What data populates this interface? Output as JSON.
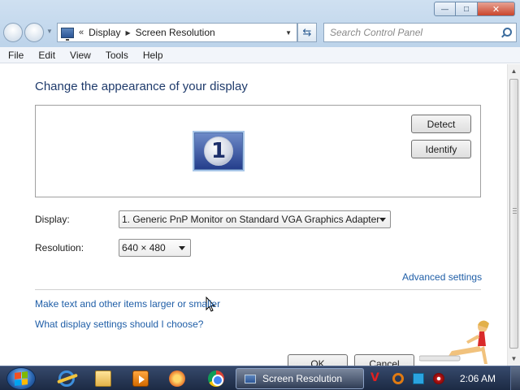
{
  "window": {
    "title": "Screen Resolution",
    "controls": {
      "minimize": "—",
      "maximize": "□",
      "close": "✕"
    }
  },
  "nav": {
    "chevrons": "«",
    "breadcrumbs": [
      "Display",
      "Screen Resolution"
    ],
    "search_placeholder": "Search Control Panel",
    "refresh_glyph": "⇆"
  },
  "menu": {
    "items": [
      "File",
      "Edit",
      "View",
      "Tools",
      "Help"
    ]
  },
  "main": {
    "title": "Change the appearance of your display",
    "monitor_number": "1",
    "detect_label": "Detect",
    "identify_label": "Identify",
    "display_label": "Display:",
    "display_value": "1. Generic PnP Monitor on Standard VGA Graphics Adapter",
    "resolution_label": "Resolution:",
    "resolution_value": "640 × 480",
    "advanced_link": "Advanced settings",
    "text_size_link": "Make text and other items larger or smaller",
    "choose_link": "What display settings should I choose?",
    "ok_label": "OK",
    "cancel_label": "Cancel"
  },
  "taskbar": {
    "active_task": "Screen Resolution",
    "clock": "2:06 AM",
    "tray_v": "V"
  },
  "colors": {
    "link": "#1f5ea7",
    "title": "#1e3a6b",
    "taskbar": "#1c2a44"
  },
  "icons": [
    "back-icon",
    "forward-icon",
    "display-icon",
    "refresh-icon",
    "search-icon",
    "windows-start-icon",
    "ie-icon",
    "folder-icon",
    "media-player-icon",
    "chrome-icon"
  ]
}
